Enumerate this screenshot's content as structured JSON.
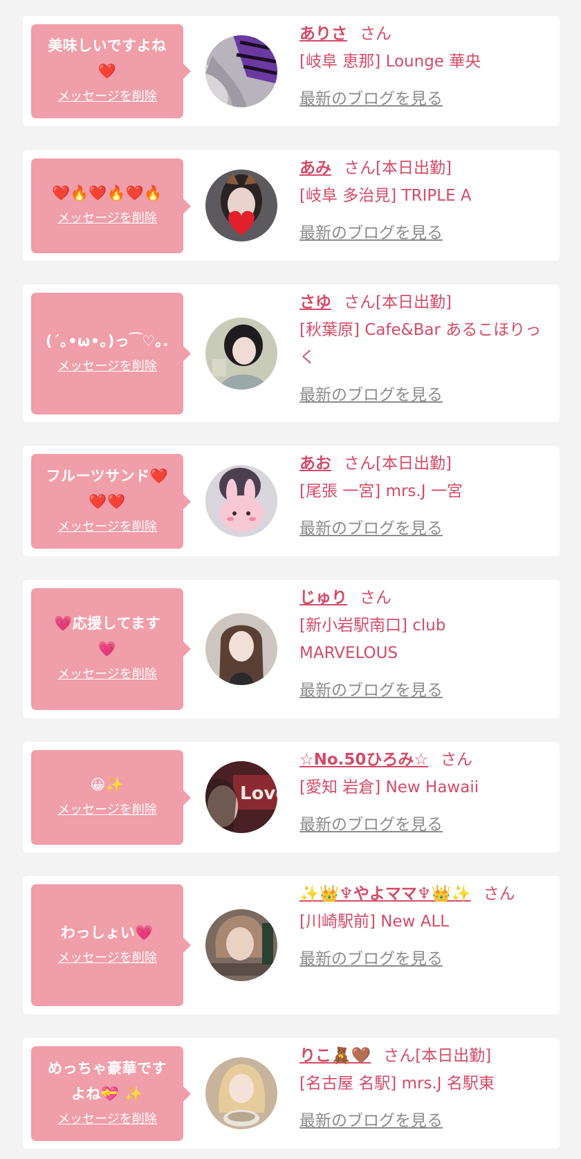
{
  "delete_label": "メッセージを削除",
  "blog_label": "最新のブログを見る",
  "colors": {
    "page_bg": "#f4f3f3",
    "card_bg": "#ffffff",
    "bubble_bg": "#f09ea9",
    "accent_text": "#d44a67",
    "link_gray": "#8b8b8b"
  },
  "items": [
    {
      "message": "美味しいですよね\n❤️",
      "name": "ありさ",
      "suffix": "さん",
      "shop": "[岐阜 恵那] Lounge 華央",
      "avatar": "avatar-photo-zebra-hair"
    },
    {
      "message": "❤️🔥❤️🔥❤️🔥",
      "name": "あみ",
      "suffix": "さん[本日出勤]",
      "shop": "[岐阜 多治見] TRIPLE A",
      "avatar": "avatar-photo-heart-sticker"
    },
    {
      "message": "(´｡•ω•｡)っ⁀♡｡.",
      "name": "さゆ",
      "suffix": "さん[本日出勤]",
      "shop": "[秋葉原] Cafe&Bar あるこほりっく",
      "avatar": "avatar-photo-dark-hair"
    },
    {
      "message": "フルーツサンド❤️\n❤️❤️",
      "name": "あお",
      "suffix": "さん[本日出勤]",
      "shop": "[尾張 一宮] mrs.J 一宮",
      "avatar": "avatar-photo-bunny-sticker"
    },
    {
      "message": "💗応援してます\n💗",
      "name": "じゅり",
      "suffix": "さん",
      "shop": "[新小岩駅南口] club MARVELOUS",
      "avatar": "avatar-photo-long-hair"
    },
    {
      "message": "😀✨",
      "name": "☆No.50ひろみ☆",
      "suffix": "さん",
      "shop": "[愛知 岩倉] New Hawaii",
      "avatar": "avatar-photo-love-sign"
    },
    {
      "message": "わっしょい💗",
      "name": "✨👑♆やよママ♆👑✨",
      "suffix": "さん",
      "shop": "[川崎駅前] New ALL",
      "avatar": "avatar-photo-mask-shop"
    },
    {
      "message": "めっちゃ豪華です\nよね💝 ✨",
      "name": "りこ🧸🤎",
      "suffix": "さん[本日出勤]",
      "shop": "[名古屋 名駅] mrs.J 名駅東",
      "avatar": "avatar-photo-blonde-bowl"
    }
  ]
}
